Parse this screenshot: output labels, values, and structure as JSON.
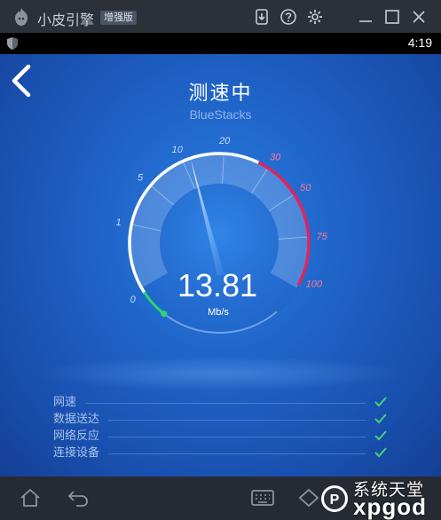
{
  "window": {
    "app_name": "小皮引擎",
    "edition_badge": "增强版",
    "icons": [
      "download-icon",
      "help-icon",
      "settings-gear-icon",
      "minimize-icon",
      "maximize-icon",
      "close-icon"
    ]
  },
  "statusbar": {
    "time": "4:19",
    "left_icon": "shield-icon"
  },
  "screen": {
    "title": "测速中",
    "subtitle": "BlueStacks",
    "speed_value": "13.81",
    "speed_unit": "Mb/s",
    "gauge": {
      "scale_labels": [
        "0",
        "1",
        "5",
        "10",
        "20",
        "30",
        "50",
        "75",
        "100"
      ],
      "needle_value": 13.81,
      "colors": {
        "white_arc": "#ffffff",
        "red_arc": "#e0245e",
        "green_start": "#2ed573"
      }
    },
    "checks": [
      {
        "label": "网速",
        "done": true
      },
      {
        "label": "数据送达",
        "done": true
      },
      {
        "label": "网络反应",
        "done": true
      },
      {
        "label": "连接设备",
        "done": true
      }
    ],
    "check_color": "#43d17a"
  },
  "navbar": {
    "icons": [
      "home-icon",
      "back-arrow-icon",
      "keyboard-icon"
    ]
  },
  "watermark": {
    "line1": "系统天堂",
    "line2": "xpgod"
  }
}
